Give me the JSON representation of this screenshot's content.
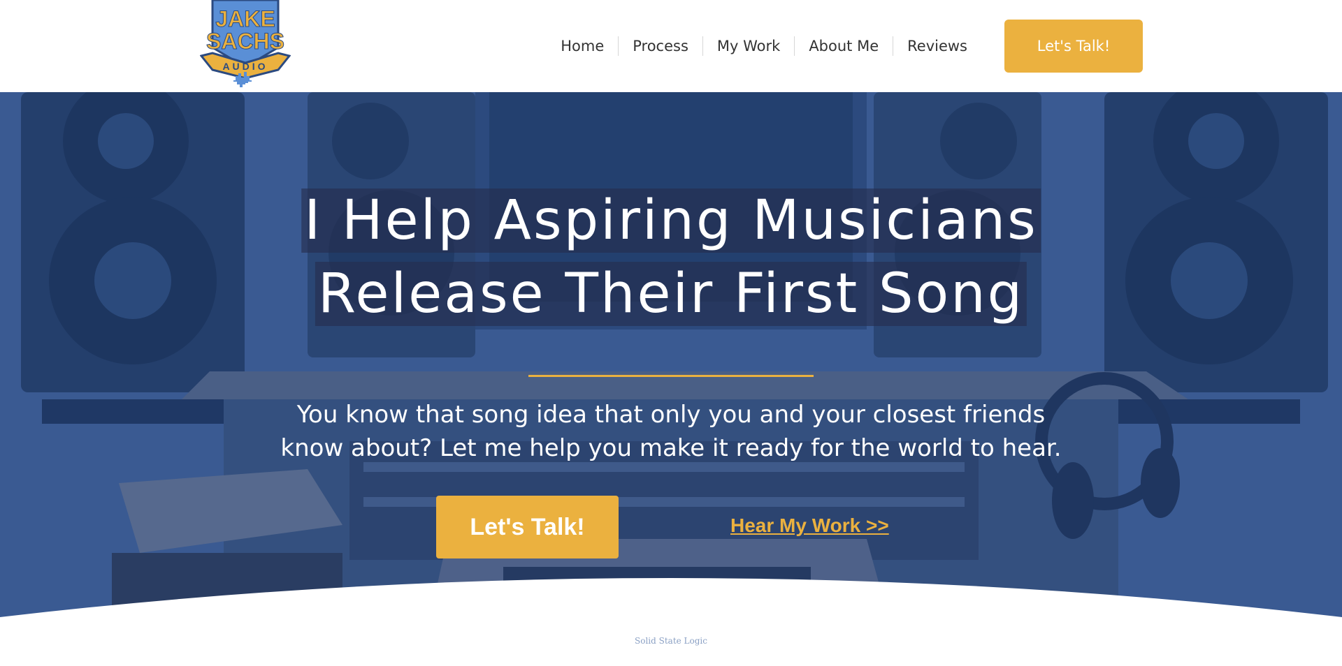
{
  "brand": {
    "logo_line1": "JAKE",
    "logo_line2": "SACHS",
    "logo_banner": "AUDIO",
    "colors": {
      "gold": "#ebb13f",
      "blue": "#5a8fd6",
      "navy": "#2b4a80"
    }
  },
  "nav": {
    "items": [
      {
        "label": "Home"
      },
      {
        "label": "Process"
      },
      {
        "label": "My Work"
      },
      {
        "label": "About Me"
      },
      {
        "label": "Reviews"
      }
    ],
    "cta_label": "Let's Talk!"
  },
  "hero": {
    "headline_line1": "I Help Aspiring Musicians",
    "headline_line2": "Release Their First Song",
    "sub_line1": "You know that song idea that only you and your closest friends",
    "sub_line2": "know about? Let me help you make it ready for the world to hear.",
    "primary_cta": "Let's Talk!",
    "secondary_link": "Hear My Work >>",
    "console_brand": "Solid State Logic",
    "overlay_color": "#2f4f86"
  }
}
